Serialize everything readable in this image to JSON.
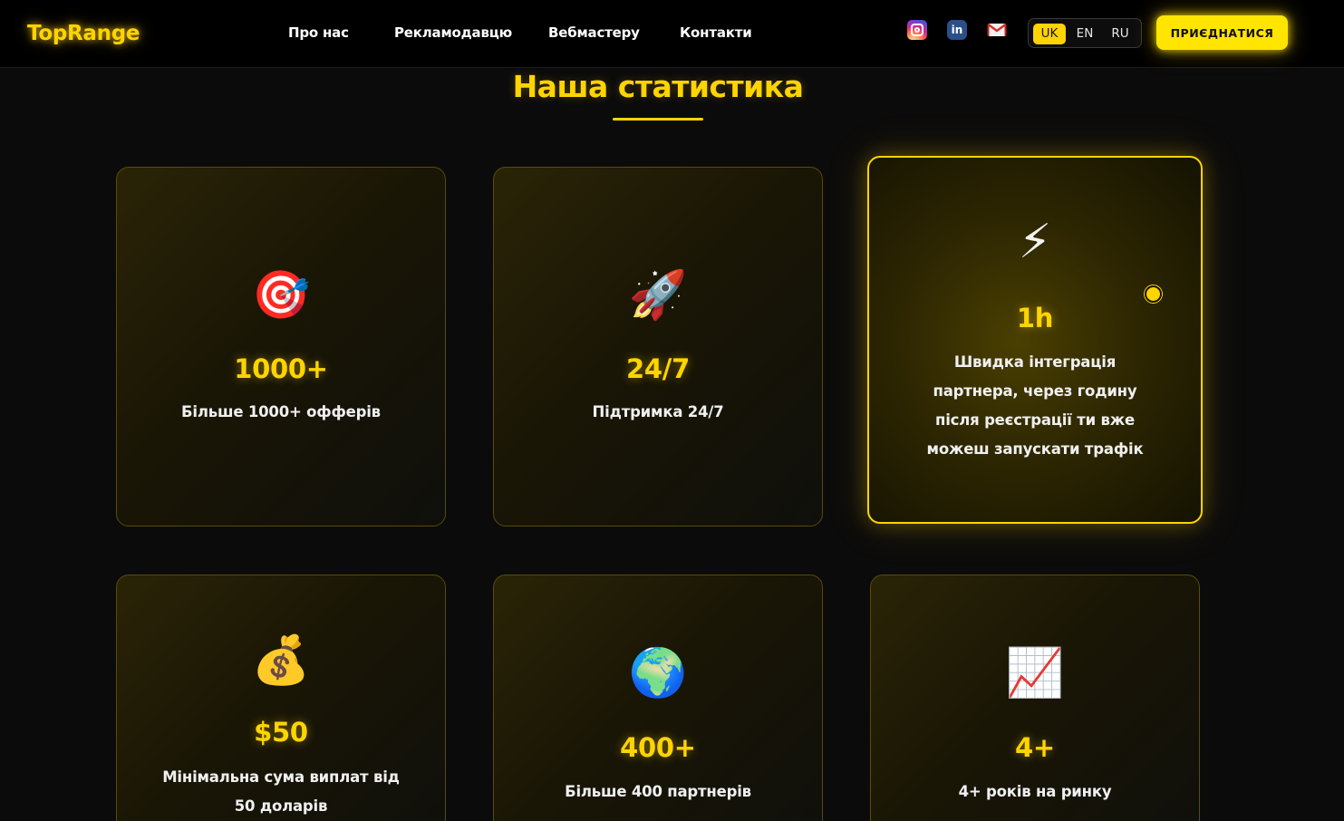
{
  "header": {
    "logo": "TopRange",
    "nav": [
      {
        "label": "Про нас"
      },
      {
        "label": "Рекламодавцю"
      },
      {
        "label": "Вебмастеру"
      },
      {
        "label": "Контакти"
      }
    ],
    "social": [
      {
        "icon": "instagram-icon"
      },
      {
        "icon": "linkedin-icon",
        "glyph": "in"
      },
      {
        "icon": "gmail-icon"
      }
    ],
    "languages": [
      {
        "code": "UK",
        "active": true
      },
      {
        "code": "EN",
        "active": false
      },
      {
        "code": "RU",
        "active": false
      }
    ],
    "join_label": "ПРИЄДНАТИСЯ"
  },
  "section": {
    "title": "Наша статистика"
  },
  "stats": [
    {
      "icon": "target-icon",
      "glyph": "🎯",
      "value": "1000+",
      "description": "Більше 1000+ офферів"
    },
    {
      "icon": "rocket-icon",
      "glyph": "🚀",
      "value": "24/7",
      "description": "Підтримка 24/7"
    },
    {
      "icon": "lightning-icon",
      "glyph": "⚡",
      "value": "1h",
      "description": "Швидка інтеграція партнера, через годину після реєстрації ти вже можеш запускати трафік",
      "active": true
    },
    {
      "icon": "money-bag-icon",
      "glyph": "💰",
      "value": "$50",
      "description": "Мінімальна сума виплат від 50 доларів"
    },
    {
      "icon": "globe-icon",
      "glyph": "🌍",
      "value": "400+",
      "description": "Більше 400 партнерів"
    },
    {
      "icon": "chart-increasing-icon",
      "glyph": "📈",
      "value": "4+",
      "description": "4+ років на ринку"
    }
  ],
  "colors": {
    "accent": "#ffd400",
    "background": "#0b0b0b",
    "header_bg": "#000000"
  }
}
